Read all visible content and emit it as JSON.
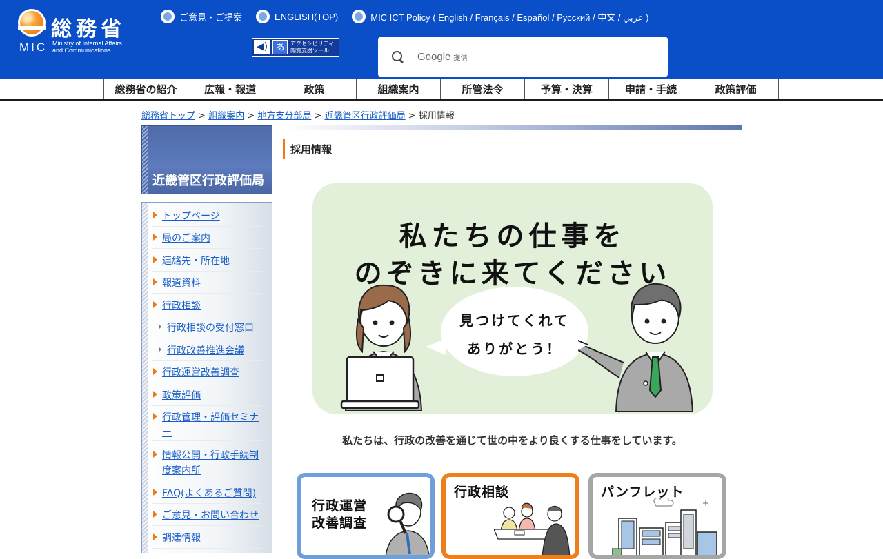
{
  "header": {
    "logo_kanji": "総務省",
    "logo_mic": "MIC",
    "logo_sub_1": "Ministry of Internal Affairs",
    "logo_sub_2": "and Communications",
    "links": [
      {
        "label": "ご意見・ご提案"
      },
      {
        "label": "ENGLISH(TOP)"
      },
      {
        "label": "MIC ICT Policy ( English / Français / Español / Русский / 中文 / عربي )"
      }
    ],
    "accessibility": {
      "line1": "アクセシビリティ",
      "line2": "閲覧支援ツール"
    },
    "search": {
      "provider": "Google",
      "suffix": "提供"
    }
  },
  "nav": [
    "総務省の紹介",
    "広報・報道",
    "政策",
    "組織案内",
    "所管法令",
    "予算・決算",
    "申請・手続",
    "政策評価"
  ],
  "breadcrumb": {
    "links": [
      "総務省トップ",
      "組織案内",
      "地方支分部局",
      "近畿管区行政評価局"
    ],
    "current": "採用情報",
    "sep": " > "
  },
  "sidebar": {
    "title": "近畿管区行政評価局",
    "items": [
      {
        "label": "トップページ"
      },
      {
        "label": "局のご案内"
      },
      {
        "label": "連絡先・所在地"
      },
      {
        "label": "報道資料"
      },
      {
        "label": "行政相談"
      },
      {
        "label": "行政相談の受付窓口"
      },
      {
        "label": "行政改善推進会議"
      },
      {
        "label": "行政運営改善調査"
      },
      {
        "label": "政策評価"
      },
      {
        "label": "行政管理・評価セミナー"
      },
      {
        "label": "情報公開・行政手続制度案内所"
      },
      {
        "label": "FAQ(よくあるご質問)"
      },
      {
        "label": "ご意見・お問い合わせ"
      },
      {
        "label": "調達情報"
      }
    ]
  },
  "main": {
    "heading": "採用情報",
    "hero": {
      "line1": "私たちの仕事を",
      "line2": "のぞきに来てください",
      "bubble1": "見つけてくれて",
      "bubble2": "ありがとう！"
    },
    "caption": "私たちは、行政の改善を通じて世の中をより良くする仕事をしています。",
    "cards": [
      {
        "line1": "行政運営",
        "line2": "改善調査",
        "border_color": "#6e9fd8"
      },
      {
        "line1": "行政相談",
        "line2": "",
        "border_color": "#ef7f1a"
      },
      {
        "line1": "パンフレット",
        "line2": "",
        "border_color": "#a6a6a6"
      }
    ]
  },
  "colors": {
    "header_bg": "#0a4fc8",
    "accent": "#ef7a14",
    "link": "#1a5fc8",
    "hero_bg": "#e2efd9"
  }
}
